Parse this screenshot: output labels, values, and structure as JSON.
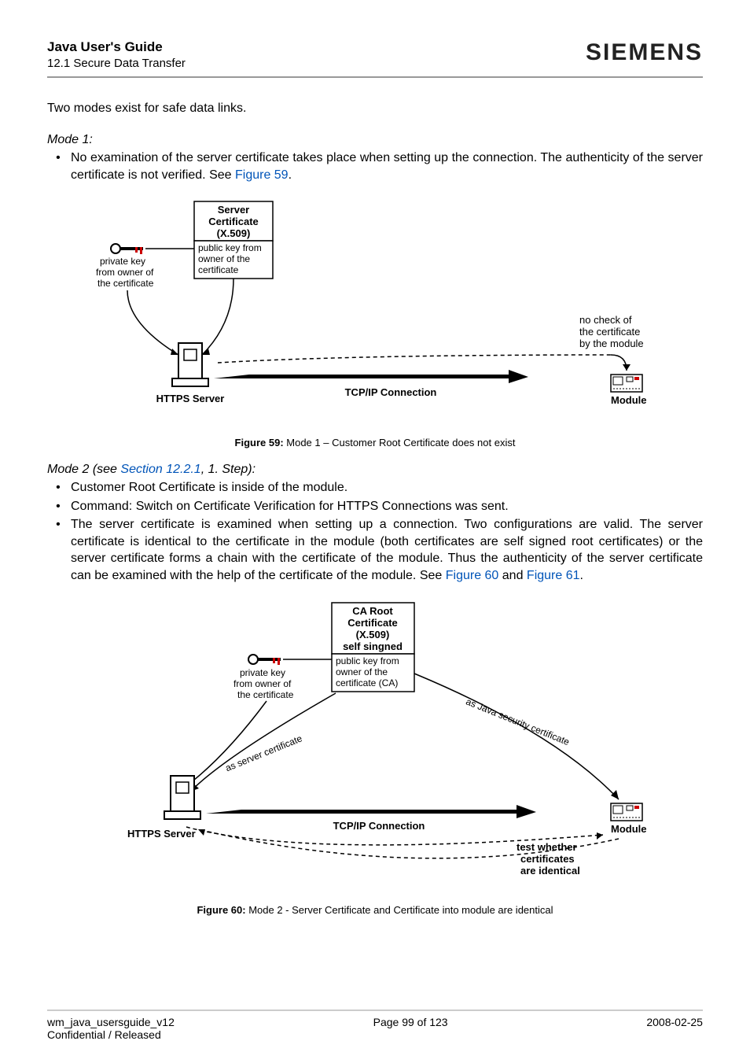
{
  "header": {
    "title": "Java User's Guide",
    "subtitle": "12.1 Secure Data Transfer",
    "brand": "SIEMENS"
  },
  "intro": "Two modes exist for safe data links.",
  "mode1": {
    "label": "Mode 1",
    "colon": ":",
    "bullet_pre": "No examination of the server certificate takes place when setting up the connection.  The authenticity of the server certificate is not verified. See ",
    "bullet_link": "Figure 59",
    "bullet_post": "."
  },
  "fig59": {
    "caption_label": "Figure 59:",
    "caption_text": "  Mode 1 – Customer Root Certificate does not exist",
    "server_cert_l1": "Server",
    "server_cert_l2": "Certificate",
    "server_cert_l3": "(X.509)",
    "pub_l1": "public key from",
    "pub_l2": "owner of the",
    "pub_l3": "certificate",
    "priv_l1": "private key",
    "priv_l2": "from owner of",
    "priv_l3": "the certificate",
    "https": "HTTPS Server",
    "tcp": "TCP/IP Connection",
    "nocheck_l1": "no check of",
    "nocheck_l2": "the certificate",
    "nocheck_l3": "by the module",
    "module": "Module"
  },
  "mode2": {
    "label": "Mode 2",
    "see_pre": " (see ",
    "see_link": "Section 12.2.1",
    "see_post": ", 1. Step",
    "see_end": "):",
    "b1": "Customer Root Certificate is inside of the module.",
    "b2": "Command: Switch on Certificate Verification for HTTPS Connections was sent.",
    "b3_pre": "The server certificate is examined when setting up a connection. Two configurations are valid. The server certificate is identical to the certificate in the module (both certificates are self signed root certificates) or the server certificate forms a chain with the certificate of the module. Thus the authenticity of the server certificate can be examined with the help of the certificate of the module. See ",
    "b3_link1": "Figure 60",
    "b3_and": " and ",
    "b3_link2": "Figure 61",
    "b3_post": "."
  },
  "fig60": {
    "caption_label": "Figure 60:",
    "caption_text": "  Mode 2 - Server Certificate and Certificate into module are identical",
    "ca_l1": "CA Root",
    "ca_l2": "Certificate",
    "ca_l3": "(X.509)",
    "ca_l4": "self singned",
    "pub_l1": "public key from",
    "pub_l2": "owner of the",
    "pub_l3": "certificate (CA)",
    "priv_l1": "private key",
    "priv_l2": "from owner of",
    "priv_l3": "the certificate",
    "as_server": "as server certificate",
    "as_java": "as Java security certificate",
    "https": "HTTPS Server",
    "tcp": "TCP/IP Connection",
    "module": "Module",
    "test_l1": "test whether",
    "test_l2": "certificates",
    "test_l3": "are identical"
  },
  "footer": {
    "left1": "wm_java_usersguide_v12",
    "left2": "Confidential / Released",
    "center": "Page 99 of 123",
    "right": "2008-02-25"
  }
}
